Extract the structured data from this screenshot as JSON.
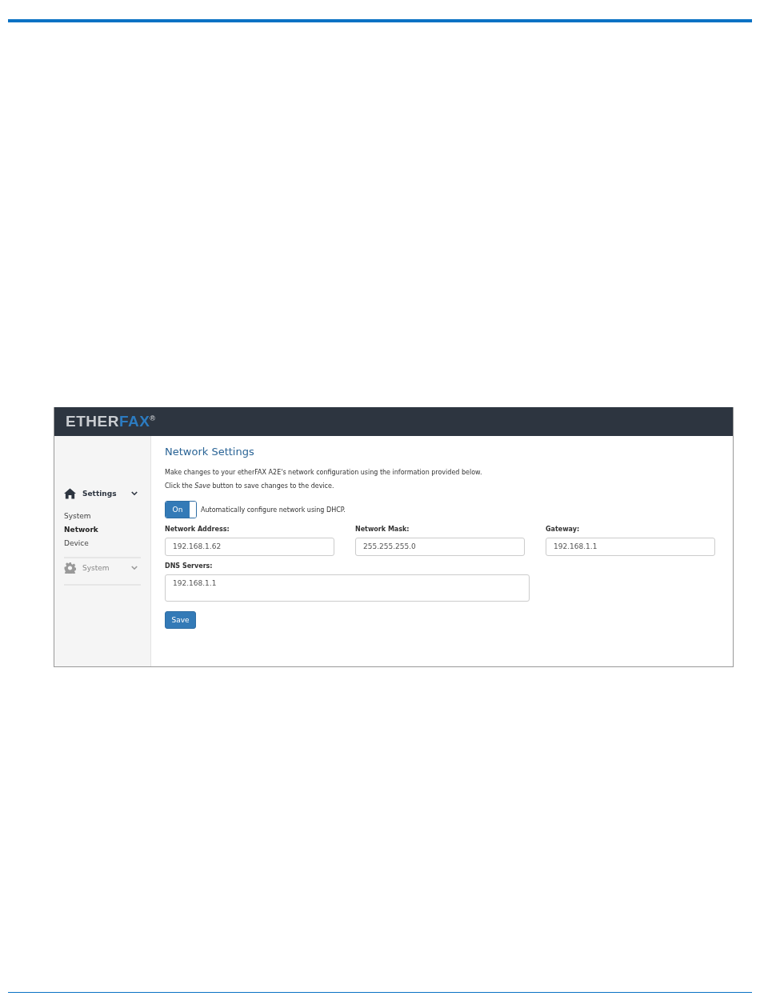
{
  "app": {
    "logo": {
      "part1": "ETHER",
      "part2": "FAX",
      "mark": "®"
    }
  },
  "sidebar": {
    "groups": [
      {
        "label": "Settings",
        "kind": "home",
        "selected": true,
        "disabled": false,
        "items": [
          {
            "label": "System",
            "selected": false
          },
          {
            "label": "Network",
            "selected": true
          },
          {
            "label": "Device",
            "selected": false
          }
        ]
      },
      {
        "label": "System",
        "kind": "gear",
        "selected": false,
        "disabled": true
      }
    ]
  },
  "content": {
    "title": "Network Settings",
    "description": [
      "Make changes to your etherFAX A2E's network configuration using the information provided below.",
      "Click the *Save* button to save changes to the device."
    ],
    "dhcp": {
      "toggle_label": "On",
      "on": true,
      "text": "Automatically configure network using DHCP."
    },
    "fields": [
      {
        "label": "Network Address:",
        "value": "192.168.1.62",
        "kind": "input"
      },
      {
        "label": "Network Mask:",
        "value": "255.255.255.0",
        "kind": "input"
      },
      {
        "label": "Gateway:",
        "value": "192.168.1.1",
        "kind": "input"
      },
      {
        "label": "DNS Servers:",
        "value": "192.168.1.1",
        "kind": "textarea"
      }
    ],
    "save_button": "Save"
  }
}
